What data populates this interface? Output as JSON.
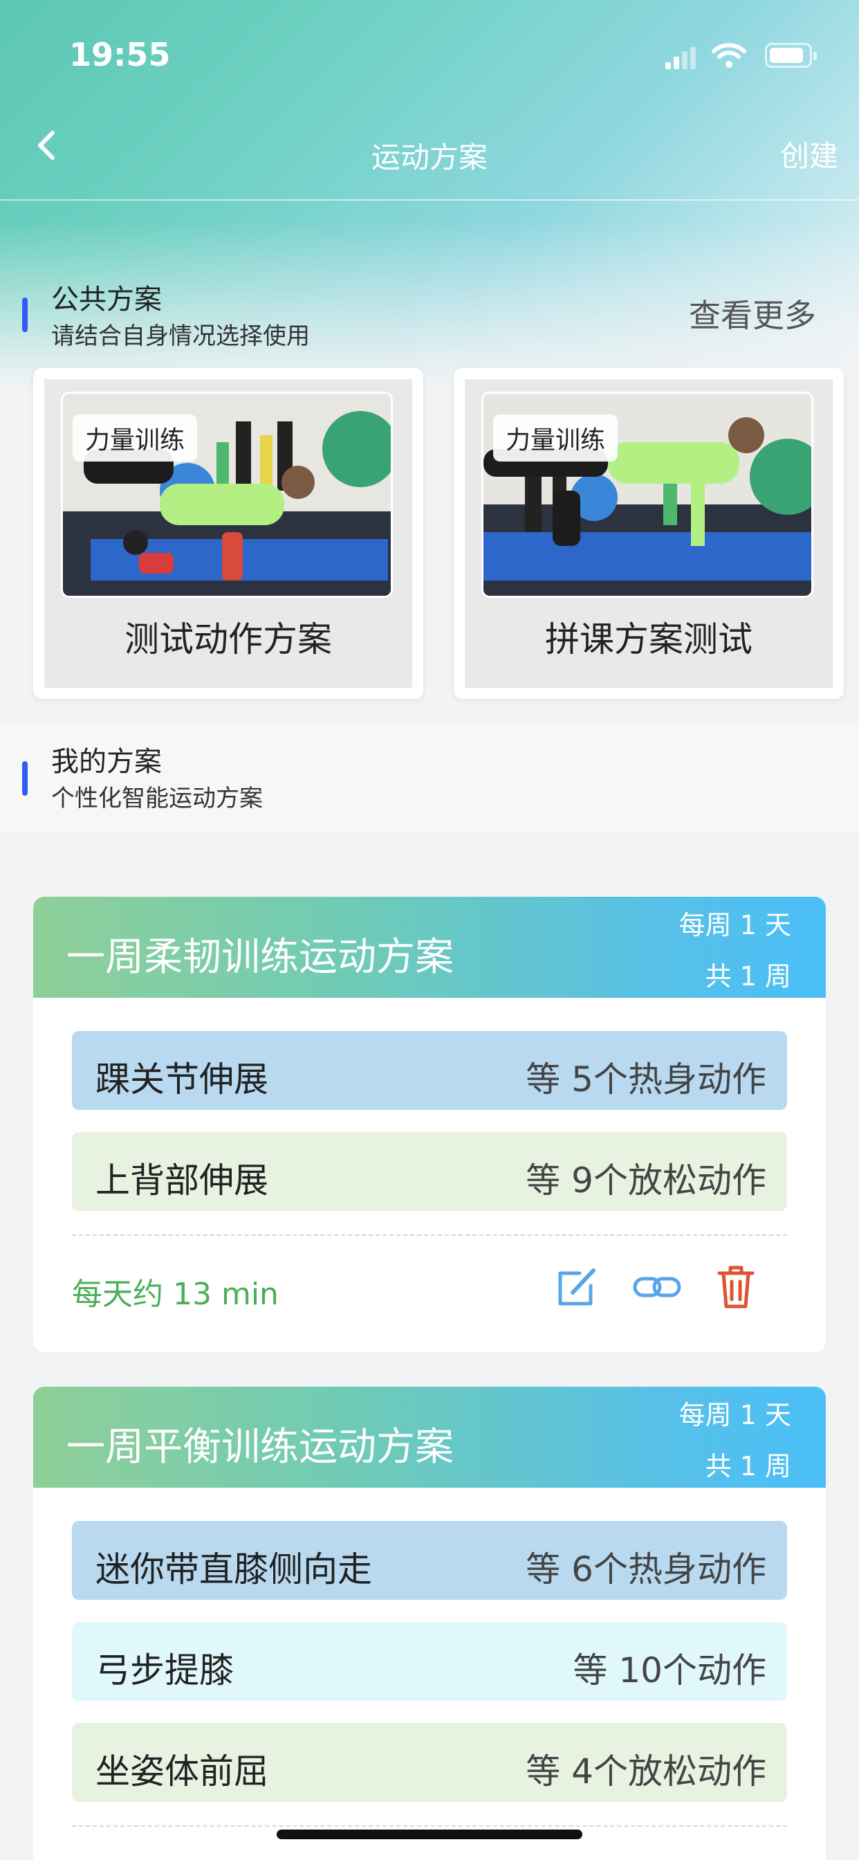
{
  "status": {
    "time": "19:55"
  },
  "nav": {
    "title": "运动方案",
    "create": "创建"
  },
  "public_section": {
    "title": "公共方案",
    "subtitle": "请结合自身情况选择使用",
    "more": "查看更多",
    "cards": [
      {
        "tag": "力量训练",
        "name": "测试动作方案"
      },
      {
        "tag": "力量训练",
        "name": "拼课方案测试"
      }
    ]
  },
  "my_section": {
    "title": "我的方案",
    "subtitle": "个性化智能运动方案"
  },
  "plans": [
    {
      "title": "一周柔韧训练运动方案",
      "frequency": "每周 1 天",
      "weeks": "共 1 周",
      "activities": [
        {
          "name": "踝关节伸展",
          "count": "等 5个热身动作",
          "color": "#b8d9ef"
        },
        {
          "name": "上背部伸展",
          "count": "等 9个放松动作",
          "color": "#e7f2e1"
        }
      ],
      "daily": "每天约 13 min"
    },
    {
      "title": "一周平衡训练运动方案",
      "frequency": "每周 1 天",
      "weeks": "共 1 周",
      "activities": [
        {
          "name": "迷你带直膝侧向走",
          "count": "等 6个热身动作",
          "color": "#b8d9ef"
        },
        {
          "name": "弓步提膝",
          "count": "等 10个动作",
          "color": "#e0f8fb"
        },
        {
          "name": "坐姿体前屈",
          "count": "等 4个放松动作",
          "color": "#e7f2e1"
        }
      ]
    }
  ],
  "colors": {
    "accent_bar": "#2f5df0",
    "daily_text": "#4cae5a",
    "edit_icon": "#5aa5e6",
    "link_icon": "#5aa5e6",
    "delete_icon": "#e0532f"
  },
  "icons": [
    "back-chevron-icon",
    "signal-icon",
    "wifi-icon",
    "battery-icon",
    "edit-icon",
    "link-icon",
    "trash-icon"
  ]
}
